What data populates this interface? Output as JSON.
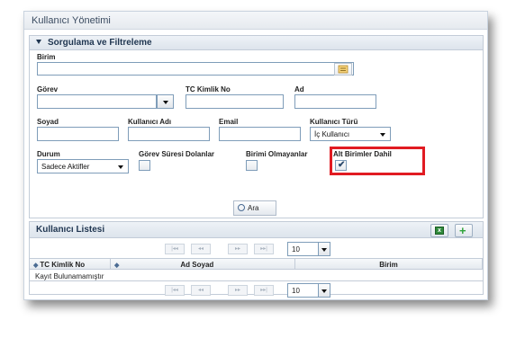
{
  "app": {
    "title": "Kullanıcı Yönetimi"
  },
  "filter": {
    "header": "Sorgulama ve Filtreleme",
    "birim": {
      "label": "Birim",
      "value": ""
    },
    "gorev": {
      "label": "Görev",
      "value": ""
    },
    "tc": {
      "label": "TC Kimlik No",
      "value": ""
    },
    "ad": {
      "label": "Ad",
      "value": ""
    },
    "soyad": {
      "label": "Soyad",
      "value": ""
    },
    "kullanici_adi": {
      "label": "Kullanıcı Adı",
      "value": ""
    },
    "email": {
      "label": "Email",
      "value": ""
    },
    "kullanici_turu": {
      "label": "Kullanıcı Türü",
      "selected": "İç Kullanıcı"
    },
    "durum": {
      "label": "Durum",
      "selected": "Sadece Aktifler"
    },
    "gorev_suresi": {
      "label": "Görev Süresi Dolanlar",
      "checked": false
    },
    "birimi_olmayanlar": {
      "label": "Birimi Olmayanlar",
      "checked": false
    },
    "alt_birimler": {
      "label": "Alt Birimler Dahil",
      "checked": true,
      "check_glyph": "✔"
    },
    "search_button": "Ara"
  },
  "list": {
    "header": "Kullanıcı Listesi",
    "columns": [
      "TC Kimlik No",
      "Ad Soyad",
      "Birim"
    ],
    "empty_text": "Kayıt Bulunamamıştır",
    "page_size": "10",
    "pager_glyphs": {
      "first": "|◂◂",
      "prev": "◂◂",
      "next": "▸▸",
      "last": "▸▸|"
    },
    "sort_glyph": "◆"
  },
  "colors": {
    "highlight": "#e11b22",
    "header_text": "#1f3550",
    "border": "#7f9db9"
  },
  "icons": [
    "collapse-icon",
    "tree-picker-icon",
    "search-icon",
    "excel-export-icon",
    "add-icon",
    "sort-icon"
  ]
}
